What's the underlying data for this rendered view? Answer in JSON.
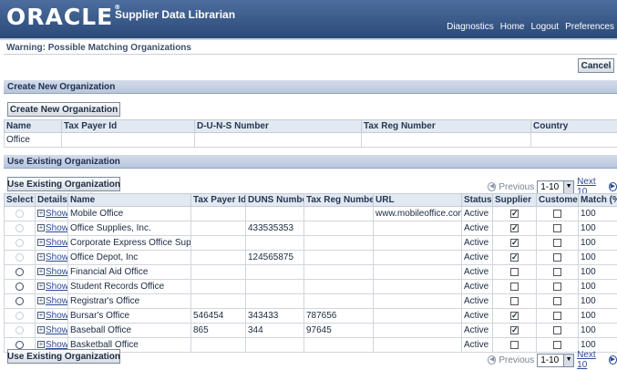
{
  "header": {
    "logo": "ORACLE",
    "app_title": "Supplier Data Librarian",
    "links": [
      "Diagnostics",
      "Home",
      "Logout",
      "Preferences"
    ]
  },
  "warning_title": "Warning: Possible Matching Organizations",
  "cancel_label": "Cancel",
  "create_section": {
    "title": "Create New Organization",
    "button": "Create New Organization",
    "columns": [
      "Name",
      "Tax Payer Id",
      "D-U-N-S Number",
      "Tax Reg Number",
      "Country"
    ],
    "row": [
      "Office",
      "",
      "",
      "",
      ""
    ]
  },
  "use_section": {
    "title": "Use Existing Organization",
    "button": "Use Existing Organization",
    "pager": {
      "previous": "Previous",
      "range": "1-10",
      "next": "Next 10"
    },
    "columns": [
      "Select",
      "Details",
      "Name",
      "Tax Payer Id",
      "DUNS Number",
      "Tax Reg Number",
      "URL",
      "Status",
      "Supplier",
      "Customer",
      "Match (%)"
    ],
    "show_label": "Show",
    "rows": [
      {
        "select_enabled": false,
        "name": "Mobile Office",
        "tax": "",
        "duns": "",
        "reg": "",
        "url": "www.mobileoffice.com",
        "status": "Active",
        "supplier": true,
        "customer": false,
        "match": "100"
      },
      {
        "select_enabled": false,
        "name": "Office Supplies, Inc.",
        "tax": "",
        "duns": "433535353",
        "reg": "",
        "url": "",
        "status": "Active",
        "supplier": true,
        "customer": false,
        "match": "100"
      },
      {
        "select_enabled": false,
        "name": "Corporate Express Office Supply",
        "tax": "",
        "duns": "",
        "reg": "",
        "url": "",
        "status": "Active",
        "supplier": true,
        "customer": false,
        "match": "100"
      },
      {
        "select_enabled": false,
        "name": "Office Depot, Inc",
        "tax": "",
        "duns": "124565875",
        "reg": "",
        "url": "",
        "status": "Active",
        "supplier": true,
        "customer": false,
        "match": "100"
      },
      {
        "select_enabled": true,
        "name": "Financial Aid Office",
        "tax": "",
        "duns": "",
        "reg": "",
        "url": "",
        "status": "Active",
        "supplier": false,
        "customer": false,
        "match": "100"
      },
      {
        "select_enabled": true,
        "name": "Student Records Office",
        "tax": "",
        "duns": "",
        "reg": "",
        "url": "",
        "status": "Active",
        "supplier": false,
        "customer": false,
        "match": "100"
      },
      {
        "select_enabled": true,
        "name": "Registrar's Office",
        "tax": "",
        "duns": "",
        "reg": "",
        "url": "",
        "status": "Active",
        "supplier": false,
        "customer": false,
        "match": "100"
      },
      {
        "select_enabled": false,
        "name": "Bursar's Office",
        "tax": "546454",
        "duns": "343433",
        "reg": "787656",
        "url": "",
        "status": "Active",
        "supplier": true,
        "customer": false,
        "match": "100"
      },
      {
        "select_enabled": false,
        "name": "Baseball Office",
        "tax": "865",
        "duns": "344",
        "reg": "97645",
        "url": "",
        "status": "Active",
        "supplier": true,
        "customer": false,
        "match": "100"
      },
      {
        "select_enabled": true,
        "name": "Basketball Office",
        "tax": "",
        "duns": "",
        "reg": "",
        "url": "",
        "status": "Active",
        "supplier": false,
        "customer": false,
        "match": "100"
      }
    ]
  }
}
